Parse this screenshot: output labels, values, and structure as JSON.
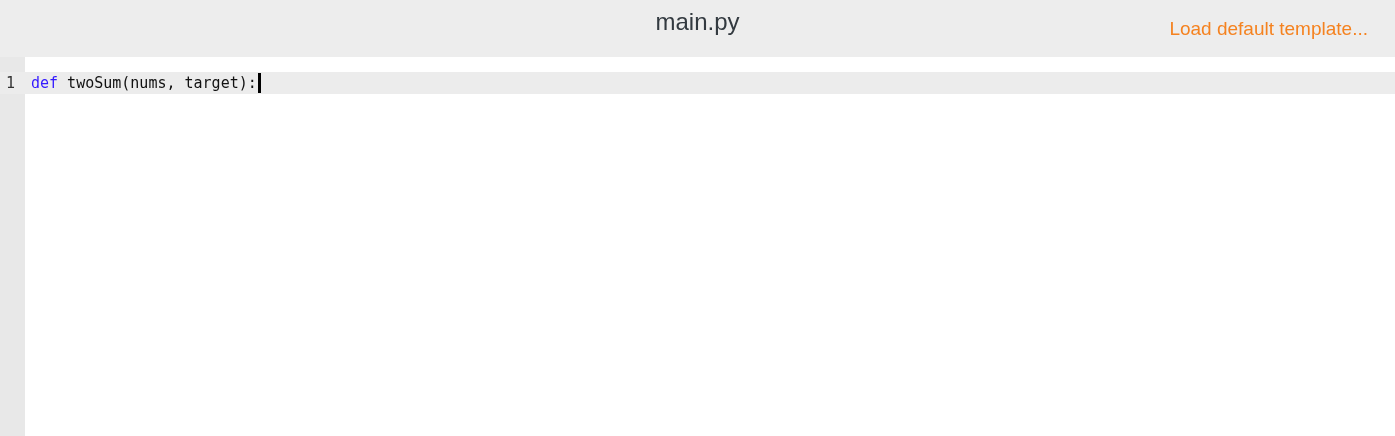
{
  "header": {
    "title": "main.py",
    "link": "Load default template..."
  },
  "editor": {
    "lines": [
      {
        "number": "1",
        "active": true,
        "cursor": true,
        "tokens": [
          {
            "kind": "keyword",
            "text": "def"
          },
          {
            "kind": "plain",
            "text": " twoSum(nums, target):"
          }
        ]
      }
    ]
  }
}
